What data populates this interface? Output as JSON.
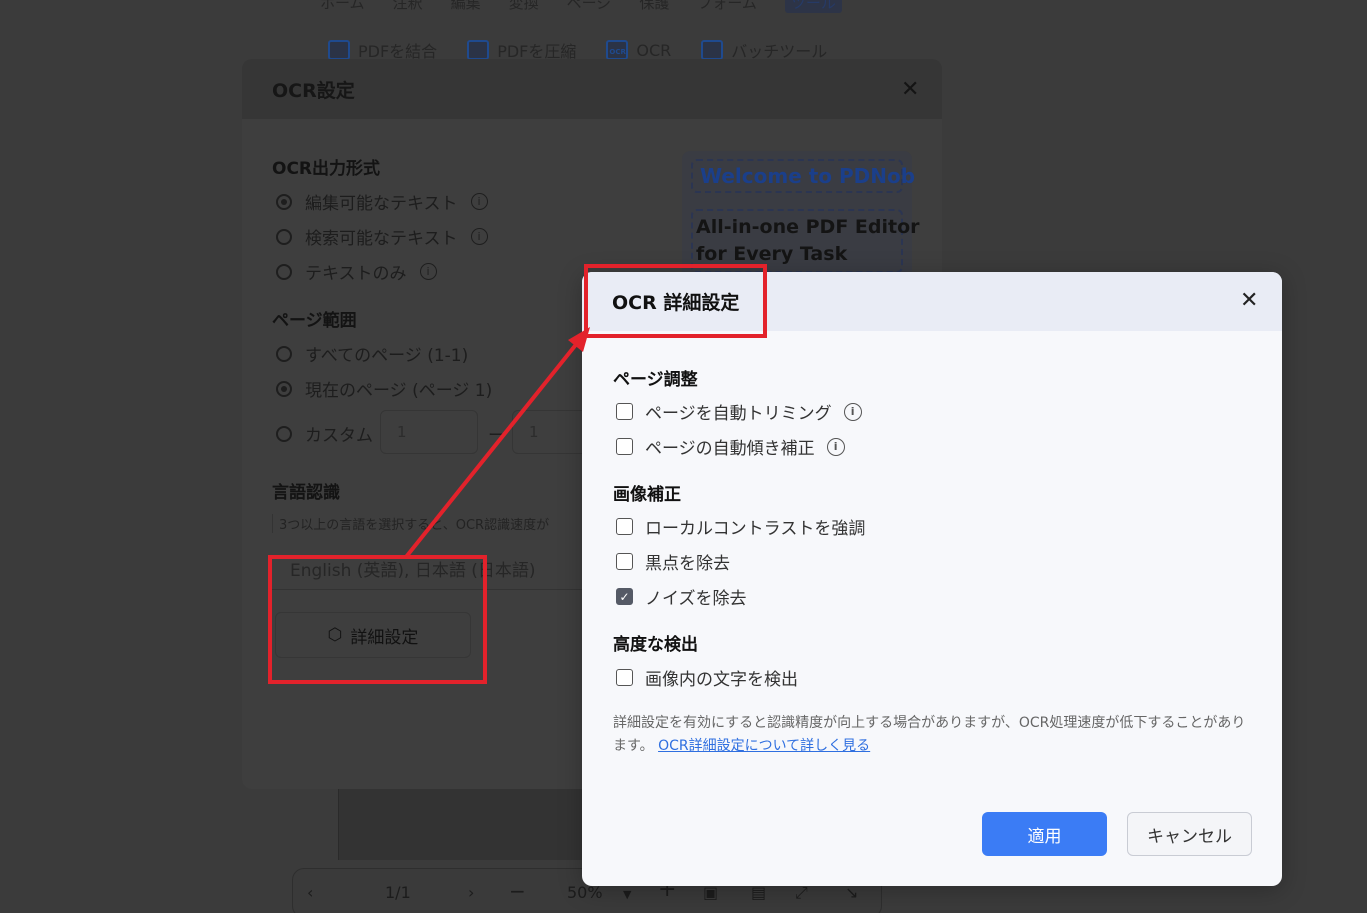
{
  "app": {
    "menu": [
      "ホーム",
      "注釈",
      "編集",
      "変換",
      "ページ",
      "保護",
      "フォーム",
      "ツール"
    ],
    "tools": [
      {
        "label": "PDFを結合",
        "icon": "merge-icon"
      },
      {
        "label": "PDFを圧縮",
        "icon": "compress-icon"
      },
      {
        "label": "OCR",
        "icon": "ocr-icon"
      },
      {
        "label": "バッチツール",
        "icon": "batch-icon"
      }
    ],
    "bottom_bar": {
      "page": "1/1",
      "zoom": "50%",
      "minus": "−",
      "plus": "+"
    }
  },
  "ocr_dialog": {
    "title": "OCR設定",
    "close": "✕",
    "output_format": {
      "title": "OCR出力形式",
      "options": [
        "編集可能なテキスト",
        "検索可能なテキスト",
        "テキストのみ"
      ],
      "selected": 0
    },
    "page_range": {
      "title": "ページ範囲",
      "options": [
        "すべてのページ (1-1)",
        "現在のページ (ページ 1)",
        "カスタム"
      ],
      "selected": 1,
      "custom_from": "1",
      "custom_to": "1",
      "dash": "ー"
    },
    "language": {
      "title": "言語認識",
      "hint": "3つ以上の言語を選択すると、OCR認識速度が",
      "value": "English (英語), 日本語 (日本語)"
    },
    "advanced_button": "詳細設定",
    "preview": {
      "line1": "Welcome to PDNob",
      "line2a": "All-in-one PDF Editor",
      "line2b": "for Every Task"
    }
  },
  "adv_dialog": {
    "title": "OCR 詳細設定",
    "close": "✕",
    "sections": [
      {
        "title": "ページ調整",
        "items": [
          {
            "label": "ページを自動トリミング",
            "checked": false,
            "info": true
          },
          {
            "label": "ページの自動傾き補正",
            "checked": false,
            "info": true
          }
        ]
      },
      {
        "title": "画像補正",
        "items": [
          {
            "label": "ローカルコントラストを強調",
            "checked": false,
            "info": false
          },
          {
            "label": "黒点を除去",
            "checked": false,
            "info": false
          },
          {
            "label": "ノイズを除去",
            "checked": true,
            "info": false
          }
        ]
      },
      {
        "title": "高度な検出",
        "items": [
          {
            "label": "画像内の文字を検出",
            "checked": false,
            "info": false
          }
        ]
      }
    ],
    "note_text": "詳細設定を有効にすると認識精度が向上する場合がありますが、OCR処理速度が低下することがあります。",
    "note_link": "OCR詳細設定について詳しく見る",
    "apply": "適用",
    "cancel": "キャンセル"
  },
  "colors": {
    "highlight": "#e3222b",
    "primary": "#3b7cf5",
    "link": "#2f6fe0"
  }
}
